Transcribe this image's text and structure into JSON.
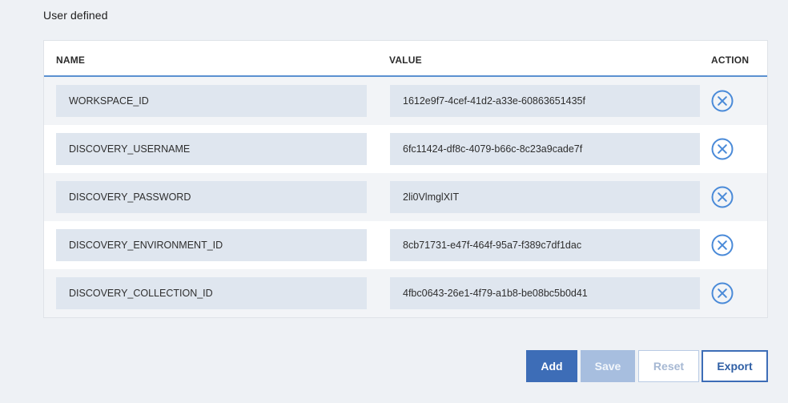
{
  "section": {
    "title": "User defined"
  },
  "table": {
    "headers": {
      "name": "NAME",
      "value": "VALUE",
      "action": "ACTION"
    },
    "rows": [
      {
        "name": "WORKSPACE_ID",
        "value": "1612e9f7-4cef-41d2-a33e-60863651435f",
        "action_icon": "remove-circle-x-icon"
      },
      {
        "name": "DISCOVERY_USERNAME",
        "value": "6fc11424-df8c-4079-b66c-8c23a9cade7f",
        "action_icon": "remove-circle-x-icon"
      },
      {
        "name": "DISCOVERY_PASSWORD",
        "value": "2li0VlmglXIT",
        "action_icon": "remove-circle-x-icon"
      },
      {
        "name": "DISCOVERY_ENVIRONMENT_ID",
        "value": "8cb71731-e47f-464f-95a7-f389c7df1dac",
        "action_icon": "remove-circle-x-icon"
      },
      {
        "name": "DISCOVERY_COLLECTION_ID",
        "value": "4fbc0643-26e1-4f79-a1b8-be08bc5b0d41",
        "action_icon": "remove-circle-x-icon"
      }
    ]
  },
  "buttons": {
    "add": "Add",
    "save": "Save",
    "reset": "Reset",
    "export": "Export"
  },
  "colors": {
    "accent": "#3d6db7",
    "accent_disabled": "#a7bedf",
    "remove_icon": "#4a8ad8",
    "cell_fill": "#dfe6ef",
    "header_rule": "#5b91d1"
  }
}
